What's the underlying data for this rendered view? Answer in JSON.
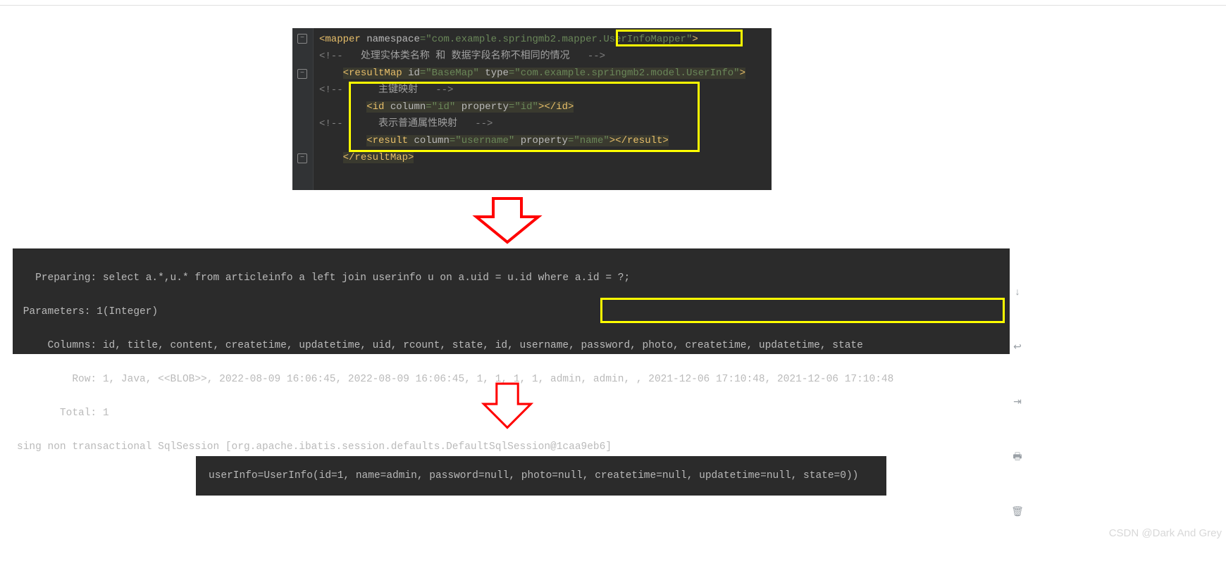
{
  "code1": {
    "line1_tag": "mapper",
    "line1_attr": "namespace",
    "line1_val_pre": "com.example.springmb2.mapper.",
    "line1_val_hl": "UserInfoMapper",
    "line2_open": "<!--",
    "line2_text": "处理实体类名称 和 数据字段名称不相同的情况",
    "line2_close": "-->",
    "line3_tag": "resultMap",
    "line3_attr1": "id",
    "line3_val1": "BaseMap",
    "line3_attr2": "type",
    "line3_val2": "com.example.springmb2.model.UserInfo",
    "line4_text": "主键映射",
    "line5_tag": "id",
    "line5_attr1": "column",
    "line5_val1": "id",
    "line5_attr2": "property",
    "line5_val2": "id",
    "line6_text": "表示普通属性映射",
    "line7_tag": "result",
    "line7_attr1": "column",
    "line7_val1": "username",
    "line7_attr2": "property",
    "line7_val2": "name",
    "line8_tag": "resultMap"
  },
  "console": {
    "l1": "   Preparing: select a.*,u.* from articleinfo a left join userinfo u on a.uid = u.id where a.id = ?;",
    "l2": " Parameters: 1(Integer)",
    "l3": "     Columns: id, title, content, createtime, updatetime, uid, rcount, state, id, username, password, photo, createtime, updatetime, state",
    "l4": "         Row: 1, Java, <<BLOB>>, 2022-08-09 16:06:45, 2022-08-09 16:06:45, 1, 1, 1, 1, admin, admin, , 2021-12-06 17:10:48, 2021-12-06 17:10:48",
    "l5": "       Total: 1",
    "l6": "sing non transactional SqlSession [org.apache.ibatis.session.defaults.DefaultSqlSession@1caa9eb6]"
  },
  "result": "userInfo=UserInfo(id=1, name=admin, password=null, photo=null, createtime=null, updatetime=null, state=0))",
  "watermark": "CSDN @Dark And Grey"
}
